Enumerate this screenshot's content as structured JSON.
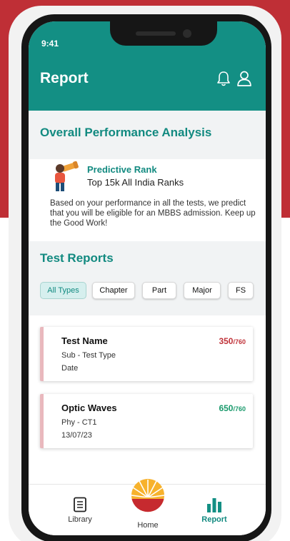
{
  "status_bar": {
    "time": "9:41"
  },
  "header": {
    "title": "Report"
  },
  "performance": {
    "heading": "Overall Performance Analysis",
    "rank_label": "Predictive Rank",
    "rank_value": "Top 15k All India Ranks",
    "description": "Based on your performance in all the tests, we predict that you will be eligible for an MBBS admission. Keep up the Good Work!"
  },
  "test_reports": {
    "heading": "Test Reports",
    "filters": [
      "All Types",
      "Chapter",
      "Part",
      "Major",
      "FS"
    ],
    "active_filter": "All Types",
    "cards": [
      {
        "name": "Test Name",
        "sub": "Sub - Test Type",
        "date": "Date",
        "score": "350",
        "total": "/760",
        "score_color": "#c0333a"
      },
      {
        "name": "Optic Waves",
        "sub": "Phy - CT1",
        "date": "13/07/23",
        "score": "650",
        "total": "/760",
        "score_color": "#1a9a6c"
      }
    ]
  },
  "bottom_nav": {
    "items": [
      {
        "label": "Library",
        "icon": "document-icon"
      },
      {
        "label": "Home",
        "icon": "sun-logo-icon"
      },
      {
        "label": "Report",
        "icon": "bar-chart-icon"
      }
    ],
    "active": "Report"
  },
  "colors": {
    "primary": "#138f84",
    "accent_red": "#bf2f36",
    "score_red": "#c0333a",
    "score_green": "#1a9a6c"
  }
}
